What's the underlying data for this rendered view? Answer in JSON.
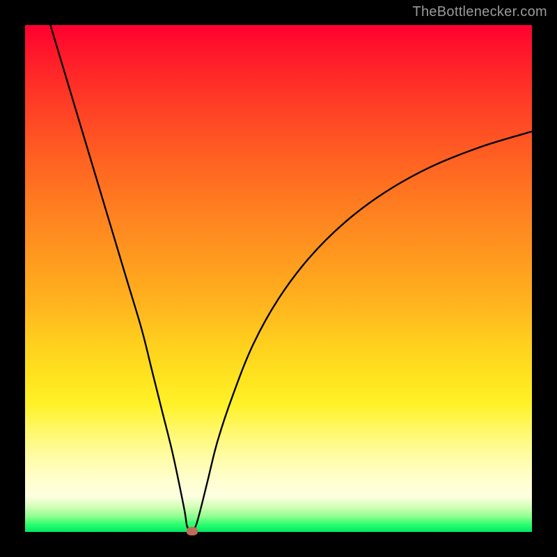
{
  "watermark": "TheBottlenecker.com",
  "colors": {
    "frame": "#000000",
    "curve": "#000000",
    "marker": "#c16a5a"
  },
  "chart_data": {
    "type": "line",
    "title": "",
    "xlabel": "",
    "ylabel": "",
    "xlim": [
      0,
      100
    ],
    "ylim": [
      0,
      100
    ],
    "series": [
      {
        "name": "bottleneck-curve",
        "x": [
          5,
          8,
          11,
          14,
          17,
          20,
          23,
          25,
          27,
          29,
          30.5,
          31.5,
          32,
          32.8,
          33.6,
          34.5,
          36,
          38,
          41,
          45,
          50,
          56,
          63,
          71,
          80,
          90,
          100
        ],
        "y": [
          100,
          90,
          80,
          70,
          60,
          50,
          40,
          32,
          24,
          16,
          9,
          4,
          1,
          0.5,
          1,
          4,
          10,
          18,
          27,
          37,
          46,
          54,
          61,
          67,
          72,
          76,
          79
        ]
      }
    ],
    "marker": {
      "x": 33,
      "y": 0.2
    },
    "grid": false,
    "legend": false
  }
}
